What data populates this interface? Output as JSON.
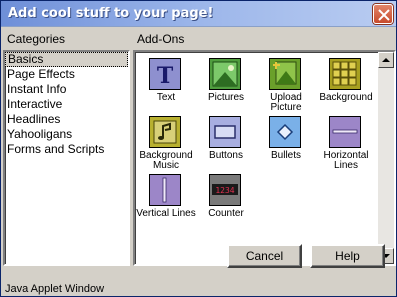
{
  "window": {
    "title": "Add cool stuff to your page!"
  },
  "categories": {
    "heading": "Categories",
    "items": [
      "Basics",
      "Page Effects",
      "Instant Info",
      "Interactive",
      "Headlines",
      "Yahooligans",
      "Forms and Scripts"
    ],
    "selected": "Basics"
  },
  "addons": {
    "heading": "Add-Ons",
    "items": [
      {
        "label": "Text",
        "icon": "text-icon"
      },
      {
        "label": "Pictures",
        "icon": "picture-icon"
      },
      {
        "label": "Upload Picture",
        "icon": "upload-picture-icon"
      },
      {
        "label": "Background",
        "icon": "background-icon"
      },
      {
        "label": "Background Music",
        "icon": "background-music-icon"
      },
      {
        "label": "Buttons",
        "icon": "buttons-icon"
      },
      {
        "label": "Bullets",
        "icon": "bullets-icon"
      },
      {
        "label": "Horizontal Lines",
        "icon": "horizontal-lines-icon"
      },
      {
        "label": "Vertical Lines",
        "icon": "vertical-lines-icon"
      },
      {
        "label": "Counter",
        "icon": "counter-icon"
      }
    ],
    "counter_value": "1234"
  },
  "buttons": {
    "cancel": "Cancel",
    "help": "Help"
  },
  "status": {
    "text": "Java Applet Window"
  },
  "colors": {
    "title_start": "#6e8fd8",
    "title_end": "#b9ccf1",
    "text_icon_bg": "#8e90cf",
    "picture_green": "#4f9d3e",
    "counter_digits": "#e0304f"
  }
}
